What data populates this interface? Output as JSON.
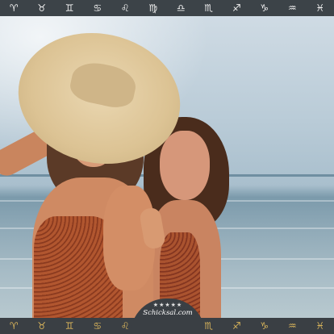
{
  "zodiac_bar": {
    "signs": [
      {
        "name": "aries-icon",
        "glyph": "♈"
      },
      {
        "name": "taurus-icon",
        "glyph": "♉"
      },
      {
        "name": "gemini-icon",
        "glyph": "♊"
      },
      {
        "name": "cancer-icon",
        "glyph": "♋"
      },
      {
        "name": "leo-icon",
        "glyph": "♌"
      },
      {
        "name": "virgo-icon",
        "glyph": "♍"
      },
      {
        "name": "libra-icon",
        "glyph": "♎"
      },
      {
        "name": "scorpio-icon",
        "glyph": "♏"
      },
      {
        "name": "sagittarius-icon",
        "glyph": "♐"
      },
      {
        "name": "capricorn-icon",
        "glyph": "♑"
      },
      {
        "name": "aquarius-icon",
        "glyph": "♒"
      },
      {
        "name": "pisces-icon",
        "glyph": "♓"
      }
    ],
    "color": "#f1f1f1",
    "background": "#3c4348"
  },
  "logo": {
    "text": "Schicksal.com",
    "stars": "★★★★★"
  },
  "bottom_bar": {
    "icons": [
      {
        "name": "ram-icon",
        "glyph": "♈"
      },
      {
        "name": "bull-icon",
        "glyph": "♉"
      },
      {
        "name": "twins-icon",
        "glyph": "♊"
      },
      {
        "name": "crab-icon",
        "glyph": "♋"
      },
      {
        "name": "lion-icon",
        "glyph": "♌"
      },
      {
        "name": "maiden-icon",
        "glyph": "♍"
      },
      {
        "name": "scales-icon",
        "glyph": "♎"
      },
      {
        "name": "scorpion-icon",
        "glyph": "♏"
      },
      {
        "name": "archer-icon",
        "glyph": "♐"
      },
      {
        "name": "goat-icon",
        "glyph": "♑"
      },
      {
        "name": "water-bearer-icon",
        "glyph": "♒"
      },
      {
        "name": "fish-icon",
        "glyph": "♓"
      }
    ],
    "color": "#d7b35b",
    "background": "#3a3f44"
  }
}
